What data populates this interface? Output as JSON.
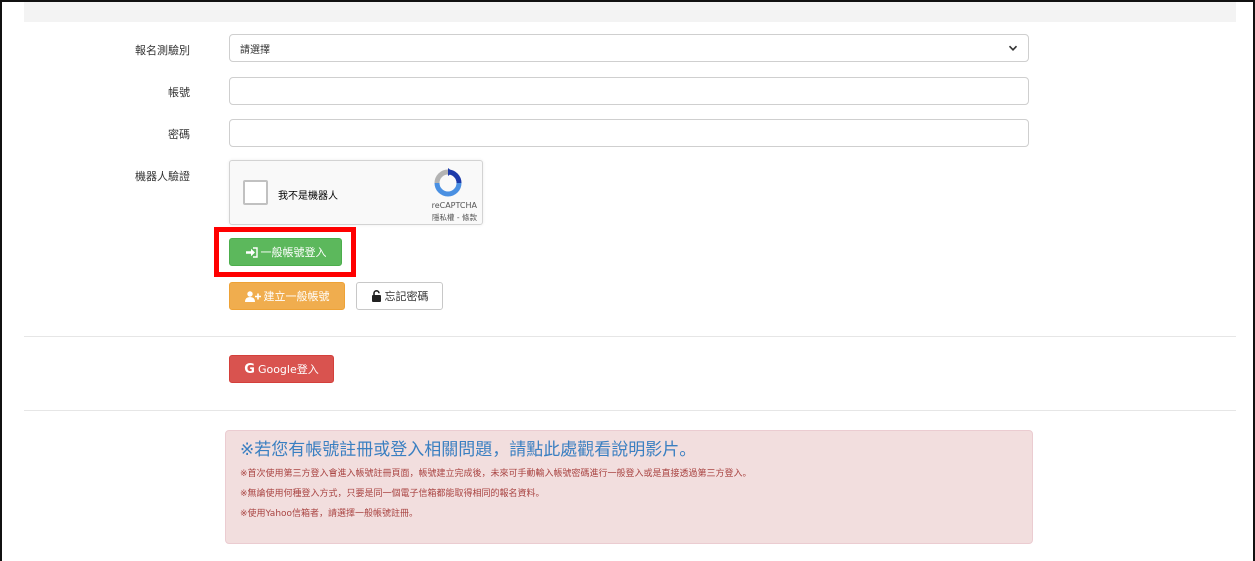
{
  "form": {
    "exam_label": "報名測驗別",
    "exam_select": {
      "selected": "請選擇"
    },
    "account_label": "帳號",
    "account_value": "",
    "password_label": "密碼",
    "password_value": "",
    "robot_label": "機器人驗證"
  },
  "recaptcha": {
    "checkbox_text": "我不是機器人",
    "brand": "reCAPTCHA",
    "links": "隱私權 - 條款"
  },
  "buttons": {
    "login": "一般帳號登入",
    "create": "建立一般帳號",
    "forgot": "忘記密碼",
    "google": "Google登入"
  },
  "notice": {
    "title": "※若您有帳號註冊或登入相關問題，請點此處觀看說明影片。",
    "lines": [
      "※首次使用第三方登入會進入帳號註冊頁面，帳號建立完成後，未來可手動輸入帳號密碼進行一般登入或是直接透過第三方登入。",
      "※無論使用何種登入方式，只要是同一個電子信箱都能取得相同的報名資料。",
      "※使用Yahoo信箱者，請選擇一般帳號註冊。"
    ]
  },
  "colors": {
    "login": "#5cb85c",
    "create": "#f0ad4e",
    "google": "#d9534f",
    "highlight": "#ff0000",
    "notice_bg": "#f2dede",
    "notice_title": "#3a7fc1",
    "notice_text": "#a94442"
  },
  "icons": {
    "login": "sign-in-icon",
    "create": "user-plus-icon",
    "forgot": "unlock-icon",
    "google": "google-icon",
    "select": "chevron-down-icon"
  }
}
